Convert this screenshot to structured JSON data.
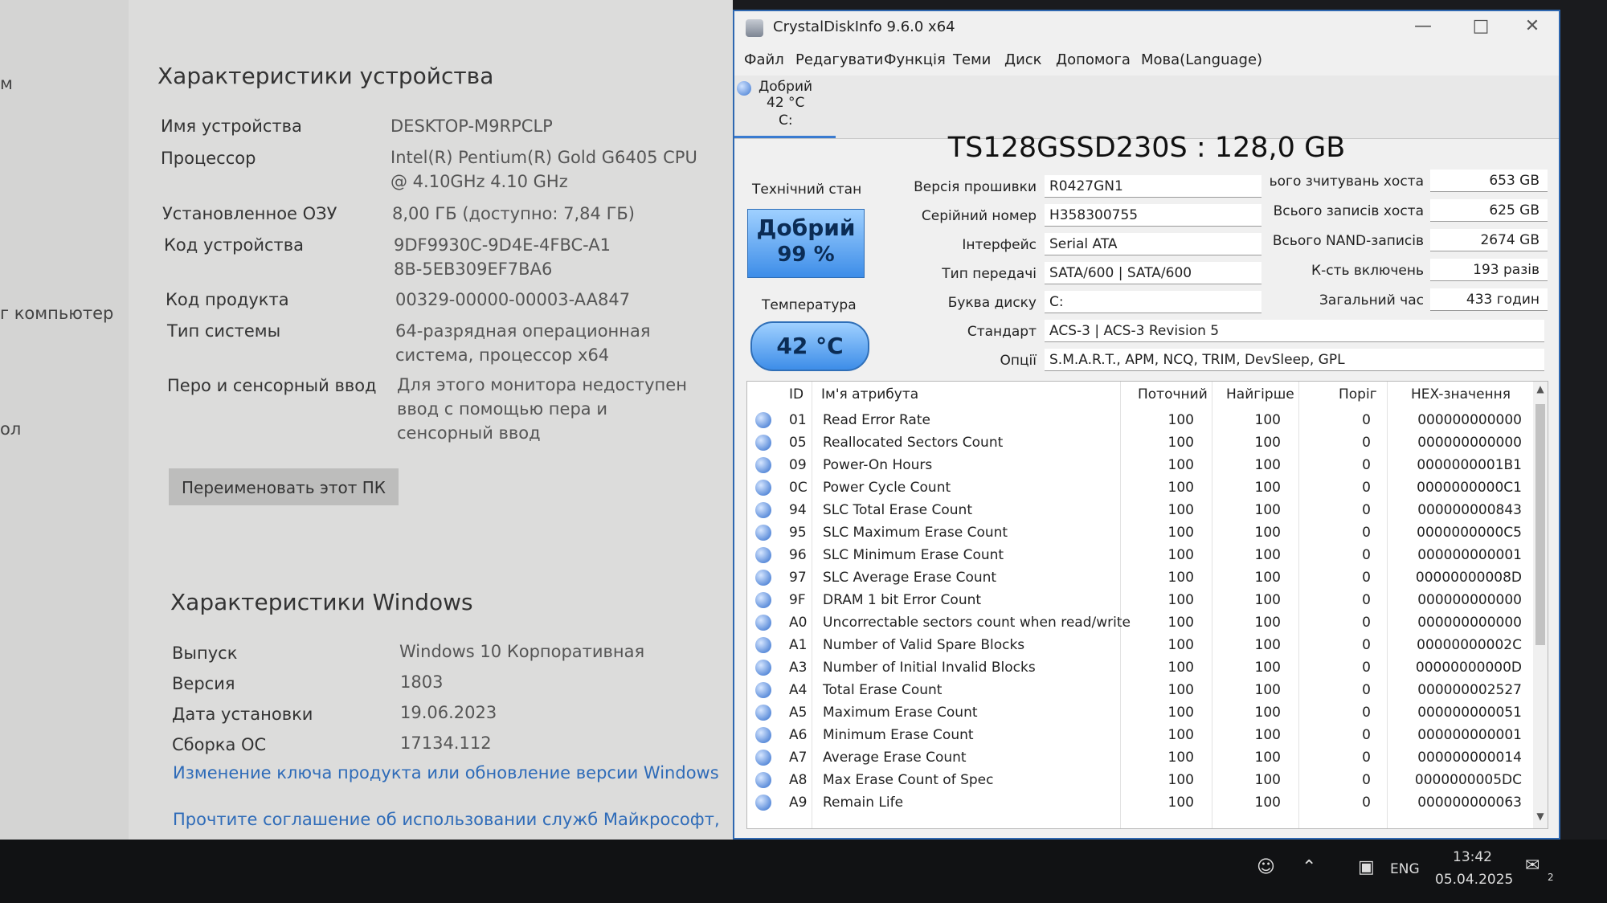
{
  "left_strip": {
    "items": [
      "м",
      "г компьютер",
      "ол"
    ]
  },
  "device": {
    "title": "Характеристики устройства",
    "rows": [
      {
        "label": "Имя устройства",
        "value": "DESKTOP-M9RPCLP"
      },
      {
        "label": "Процессор",
        "value": "Intel(R) Pentium(R) Gold G6405 CPU @ 4.10GHz   4.10 GHz"
      },
      {
        "label": "Установленное ОЗУ",
        "value": "8,00 ГБ (доступно: 7,84 ГБ)"
      },
      {
        "label": "Код устройства",
        "value": "9DF9930C-9D4E-4FBC-A18B-5EB309EF7BA6"
      },
      {
        "label": "Код продукта",
        "value": "00329-00000-00003-AA847"
      },
      {
        "label": "Тип системы",
        "value": "64-разрядная операционная система, процессор x64"
      },
      {
        "label": "Перо и сенсорный ввод",
        "value": "Для этого монитора недоступен ввод с помощью пера и сенсорный ввод"
      }
    ],
    "rename_button": "Переименовать этот ПК"
  },
  "windows": {
    "title": "Характеристики Windows",
    "rows": [
      {
        "label": "Выпуск",
        "value": "Windows 10 Корпоративная"
      },
      {
        "label": "Версия",
        "value": "1803"
      },
      {
        "label": "Дата установки",
        "value": "19.06.2023"
      },
      {
        "label": "Сборка ОС",
        "value": "17134.112"
      }
    ],
    "link1": "Изменение ключа продукта или обновление версии Windows",
    "link2": "Прочтите соглашение об использовании служб Майкрософт,"
  },
  "cdi": {
    "title": "CrystalDiskInfo 9.6.0 x64",
    "menu": [
      "Файл",
      "Редагувати",
      "Функція",
      "Теми",
      "Диск",
      "Допомога",
      "Мова(Language)"
    ],
    "disk_tab": {
      "status": "Добрий",
      "temp": "42 °C",
      "letter": "C:"
    },
    "model": "TS128GSSD230S : 128,0 GB",
    "health_label": "Технічний стан",
    "health_status": "Добрий",
    "health_percent": "99 %",
    "temp_label": "Температура",
    "temp_value": "42 °C",
    "fields": [
      {
        "label": "Версія прошивки",
        "value": "R0427GN1"
      },
      {
        "label": "Серійний номер",
        "value": "H358300755"
      },
      {
        "label": "Інтерфейс",
        "value": "Serial ATA"
      },
      {
        "label": "Тип передачі",
        "value": "SATA/600 | SATA/600"
      },
      {
        "label": "Буква диску",
        "value": "C:"
      },
      {
        "label": "Стандарт",
        "value": "ACS-3 | ACS-3 Revision 5"
      },
      {
        "label": "Опції",
        "value": "S.M.A.R.T., APM, NCQ, TRIM, DevSleep, GPL"
      }
    ],
    "right_fields": [
      {
        "label": "ього зчитувань хоста",
        "value": "653 GB"
      },
      {
        "label": "Всього записів хоста",
        "value": "625 GB"
      },
      {
        "label": "Всього NAND-записів",
        "value": "2674 GB"
      },
      {
        "label": "К-сть включень",
        "value": "193 разів"
      },
      {
        "label": "Загальний час",
        "value": "433 годин"
      }
    ],
    "table_headers": {
      "id": "ID",
      "name": "Ім'я атрибута",
      "current": "Поточний",
      "worst": "Найгірше",
      "threshold": "Поріг",
      "raw": "HEX-значення"
    },
    "attributes": [
      {
        "id": "01",
        "name": "Read Error Rate",
        "current": "100",
        "worst": "100",
        "threshold": "0",
        "raw": "000000000000"
      },
      {
        "id": "05",
        "name": "Reallocated Sectors Count",
        "current": "100",
        "worst": "100",
        "threshold": "0",
        "raw": "000000000000"
      },
      {
        "id": "09",
        "name": "Power-On Hours",
        "current": "100",
        "worst": "100",
        "threshold": "0",
        "raw": "0000000001B1"
      },
      {
        "id": "0C",
        "name": "Power Cycle Count",
        "current": "100",
        "worst": "100",
        "threshold": "0",
        "raw": "0000000000C1"
      },
      {
        "id": "94",
        "name": "SLC Total Erase Count",
        "current": "100",
        "worst": "100",
        "threshold": "0",
        "raw": "000000000843"
      },
      {
        "id": "95",
        "name": "SLC Maximum Erase Count",
        "current": "100",
        "worst": "100",
        "threshold": "0",
        "raw": "0000000000C5"
      },
      {
        "id": "96",
        "name": "SLC Minimum Erase Count",
        "current": "100",
        "worst": "100",
        "threshold": "0",
        "raw": "000000000001"
      },
      {
        "id": "97",
        "name": "SLC Average Erase Count",
        "current": "100",
        "worst": "100",
        "threshold": "0",
        "raw": "00000000008D"
      },
      {
        "id": "9F",
        "name": "DRAM 1 bit Error Count",
        "current": "100",
        "worst": "100",
        "threshold": "0",
        "raw": "000000000000"
      },
      {
        "id": "A0",
        "name": "Uncorrectable sectors count when read/write",
        "current": "100",
        "worst": "100",
        "threshold": "0",
        "raw": "000000000000"
      },
      {
        "id": "A1",
        "name": "Number of Valid Spare Blocks",
        "current": "100",
        "worst": "100",
        "threshold": "0",
        "raw": "00000000002C"
      },
      {
        "id": "A3",
        "name": "Number of Initial Invalid Blocks",
        "current": "100",
        "worst": "100",
        "threshold": "0",
        "raw": "00000000000D"
      },
      {
        "id": "A4",
        "name": "Total Erase Count",
        "current": "100",
        "worst": "100",
        "threshold": "0",
        "raw": "000000002527"
      },
      {
        "id": "A5",
        "name": "Maximum Erase Count",
        "current": "100",
        "worst": "100",
        "threshold": "0",
        "raw": "000000000051"
      },
      {
        "id": "A6",
        "name": "Minimum Erase Count",
        "current": "100",
        "worst": "100",
        "threshold": "0",
        "raw": "000000000001"
      },
      {
        "id": "A7",
        "name": "Average Erase Count",
        "current": "100",
        "worst": "100",
        "threshold": "0",
        "raw": "000000000014"
      },
      {
        "id": "A8",
        "name": "Max Erase Count of Spec",
        "current": "100",
        "worst": "100",
        "threshold": "0",
        "raw": "0000000005DC"
      },
      {
        "id": "A9",
        "name": "Remain Life",
        "current": "100",
        "worst": "100",
        "threshold": "0",
        "raw": "000000000063"
      }
    ]
  },
  "taskbar": {
    "lang": "ENG",
    "time": "13:42",
    "date": "05.04.2025",
    "notify_count": "2"
  },
  "colors": {
    "accent": "#2e67b0",
    "health_blue": "#3d8de8",
    "link": "#2e6bb8"
  }
}
